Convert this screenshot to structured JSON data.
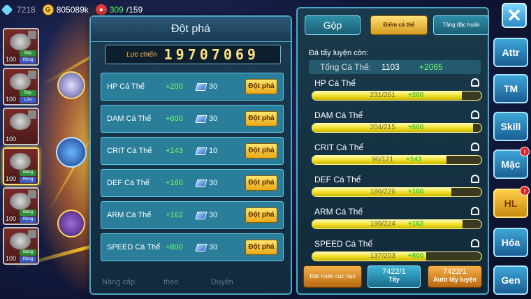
{
  "topbar": {
    "gems": "7218",
    "coins": "805089k",
    "fruit_current": "309",
    "fruit_max": "/159"
  },
  "team": [
    {
      "level": "100",
      "tag1": "Bay",
      "tag2": "Rồng"
    },
    {
      "level": "100",
      "tag1": "Bay",
      "tag2": "Lửa"
    },
    {
      "level": "100",
      "tag1": "",
      "tag2": ""
    },
    {
      "level": "100",
      "tag1": "Băng",
      "tag2": "Rồng"
    },
    {
      "level": "100",
      "tag1": "Băng",
      "tag2": "Rồng"
    },
    {
      "level": "100",
      "tag1": "Băng",
      "tag2": "Rồng"
    }
  ],
  "breakthrough": {
    "title": "Đột phá",
    "power_label": "Lực chiến",
    "power_value": "19707069",
    "button_label": "Đột phá",
    "rows": [
      {
        "name": "HP Cá Thể",
        "plus": "+200",
        "cost": "30"
      },
      {
        "name": "DAM Cá Thể",
        "plus": "+600",
        "cost": "30"
      },
      {
        "name": "CRIT Cá Thể",
        "plus": "+143",
        "cost": "10"
      },
      {
        "name": "DEF Cá Thể",
        "plus": "+160",
        "cost": "30"
      },
      {
        "name": "ARM Cá Thể",
        "plus": "+162",
        "cost": "30"
      },
      {
        "name": "SPEED Cá Thể",
        "plus": "+800",
        "cost": "30"
      }
    ]
  },
  "bottom_nav": {
    "item1": "Nâng cấp",
    "item2": "theo",
    "item3": "Duyên"
  },
  "training": {
    "tabs": {
      "gop": "Gộp",
      "diem": "Điểm cá thể",
      "tang": "Tăng đặc huấn"
    },
    "remain_label": "Đá tẩy luyện còn:",
    "total_label": "Tổng Cá Thể:",
    "total_value": "1103",
    "total_plus": "+2065",
    "stats": [
      {
        "name": "HP Cá Thể",
        "current": "231/261",
        "plus": "+200",
        "fill": 0.885
      },
      {
        "name": "DAM Cá Thể",
        "current": "204/215",
        "plus": "+600",
        "fill": 0.949
      },
      {
        "name": "CRIT Cá Thể",
        "current": "96/121",
        "plus": "+143",
        "fill": 0.793
      },
      {
        "name": "DEF Cá Thể",
        "current": "186/226",
        "plus": "+160",
        "fill": 0.823
      },
      {
        "name": "ARM Cá Thể",
        "current": "199/224",
        "plus": "+162",
        "fill": 0.888
      },
      {
        "name": "SPEED Cá Thể",
        "current": "137/203",
        "plus": "+800",
        "fill": 0.675
      }
    ],
    "buttons": {
      "dac_huan": "Đặc huấn cực hạn",
      "tay_count": "7422/1",
      "tay_label": "Tẩy",
      "auto_count": "7422/1",
      "auto_label": "Auto tẩy luyện"
    }
  },
  "side_menu": [
    "Attr",
    "TM",
    "Skill",
    "Mặc",
    "HL",
    "Hóa",
    "Gen"
  ],
  "close_label": "✕"
}
